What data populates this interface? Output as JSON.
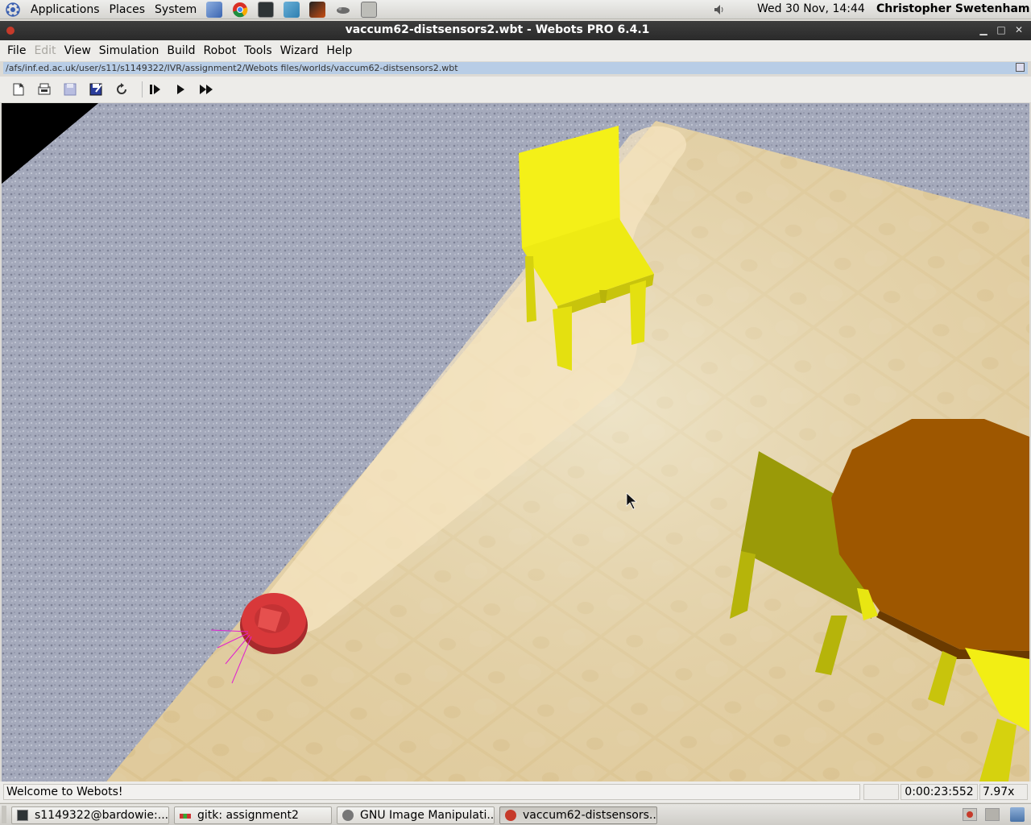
{
  "top_panel": {
    "menus": [
      "Applications",
      "Places",
      "System"
    ],
    "launchers": [
      "cube-icon",
      "chrome-icon",
      "terminal-icon",
      "network-icon",
      "matlab-icon",
      "gimp-wilber-icon",
      "notes-icon"
    ],
    "clock": "Wed 30 Nov, 14:44",
    "user": "Christopher Swetenham"
  },
  "window": {
    "title": "vaccum62-distsensors2.wbt - Webots PRO 6.4.1"
  },
  "menubar": {
    "items": [
      {
        "label": "File",
        "enabled": true
      },
      {
        "label": "Edit",
        "enabled": false
      },
      {
        "label": "View",
        "enabled": true
      },
      {
        "label": "Simulation",
        "enabled": true
      },
      {
        "label": "Build",
        "enabled": true
      },
      {
        "label": "Robot",
        "enabled": true
      },
      {
        "label": "Tools",
        "enabled": true
      },
      {
        "label": "Wizard",
        "enabled": true
      },
      {
        "label": "Help",
        "enabled": true
      }
    ]
  },
  "path": "/afs/inf.ed.ac.uk/user/s11/s1149322/IVR/assignment2/Webots files/worlds/vaccum62-distsensors2.wbt",
  "toolbar": {
    "buttons": [
      "new-world-icon",
      "open-icon",
      "save-icon",
      "save-as-icon",
      "revert-icon",
      "step-icon",
      "run-icon",
      "fast-icon"
    ]
  },
  "status": {
    "message": "Welcome to Webots!",
    "time": "0:00:23:552",
    "speed": "7.97x"
  },
  "taskbar": {
    "tasks": [
      {
        "label": "s1149322@bardowie:...",
        "icon": "terminal-icon"
      },
      {
        "label": "gitk: assignment2",
        "icon": "gitk-icon"
      },
      {
        "label": "GNU Image Manipulati...",
        "icon": "gimp-icon"
      },
      {
        "label": "vaccum62-distsensors...",
        "icon": "webots-icon"
      }
    ]
  },
  "colors": {
    "wall": "#9aa0b4",
    "floor": "#e0c795",
    "chair_yellow": "#f0ee10",
    "table": "#a05a00",
    "robot": "#d8383a",
    "sensor_rays": "#e020d0"
  }
}
